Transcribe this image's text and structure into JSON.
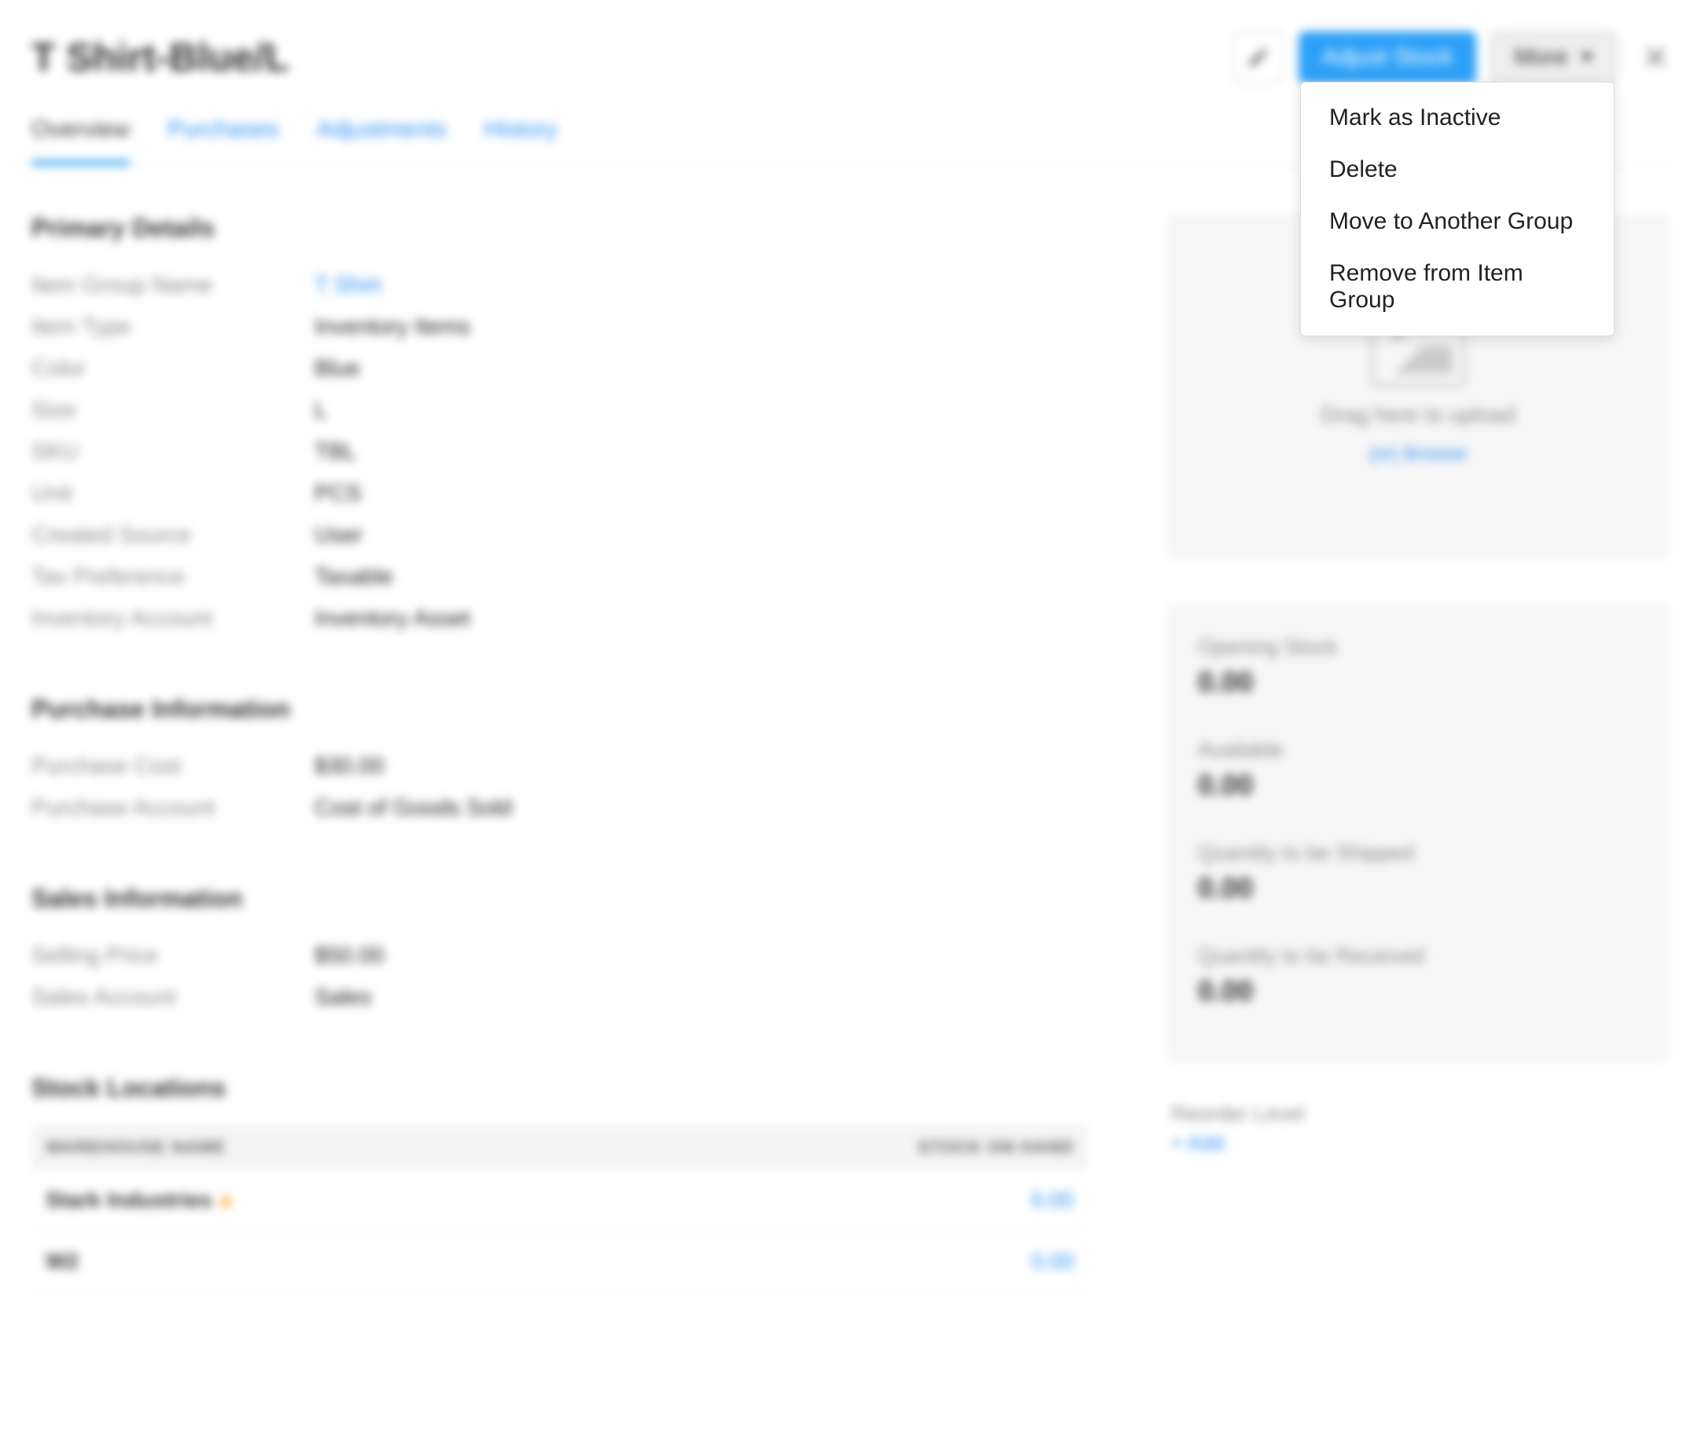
{
  "header": {
    "title": "T Shirt-Blue/L",
    "adjust_stock_label": "Adjust Stock",
    "more_label": "More"
  },
  "tabs": [
    {
      "label": "Overview",
      "active": true
    },
    {
      "label": "Purchases",
      "active": false
    },
    {
      "label": "Adjustments",
      "active": false
    },
    {
      "label": "History",
      "active": false
    }
  ],
  "more_menu": {
    "items": [
      "Mark as Inactive",
      "Delete",
      "Move to Another Group",
      "Remove from Item Group"
    ]
  },
  "sections": {
    "primary": {
      "heading": "Primary Details",
      "rows": [
        {
          "label": "Item Group Name",
          "value": "T Shirt",
          "link": true
        },
        {
          "label": "Item Type",
          "value": "Inventory Items"
        },
        {
          "label": "Color",
          "value": "Blue"
        },
        {
          "label": "Size",
          "value": "L"
        },
        {
          "label": "SKU",
          "value": "TBL"
        },
        {
          "label": "Unit",
          "value": "PCS"
        },
        {
          "label": "Created Source",
          "value": "User"
        },
        {
          "label": "Tax Preference",
          "value": "Taxable"
        },
        {
          "label": "Inventory Account",
          "value": "Inventory Asset"
        }
      ]
    },
    "purchase": {
      "heading": "Purchase Information",
      "rows": [
        {
          "label": "Purchase Cost",
          "value": "$30.00"
        },
        {
          "label": "Purchase Account",
          "value": "Cost of Goods Sold"
        }
      ]
    },
    "sales": {
      "heading": "Sales Information",
      "rows": [
        {
          "label": "Selling Price",
          "value": "$50.00"
        },
        {
          "label": "Sales Account",
          "value": "Sales"
        }
      ]
    },
    "stock_locations": {
      "heading": "Stock Locations",
      "columns": {
        "name": "WAREHOUSE NAME",
        "stock": "STOCK ON HAND"
      },
      "rows": [
        {
          "name": "Stark Industries",
          "primary": true,
          "stock": "0.00"
        },
        {
          "name": "W2",
          "primary": false,
          "stock": "0.00"
        }
      ]
    }
  },
  "upload": {
    "drag_text": "Drag here to upload",
    "browse_text": "(or) Browse"
  },
  "stats": [
    {
      "label": "Opening Stock",
      "value": "0.00"
    },
    {
      "label": "Available",
      "value": "0.00"
    },
    {
      "label": "Quantity to be Shipped",
      "value": "0.00"
    },
    {
      "label": "Quantity to be Received",
      "value": "0.00"
    }
  ],
  "reorder": {
    "label": "Reorder Level",
    "add_label": "+ Add"
  }
}
